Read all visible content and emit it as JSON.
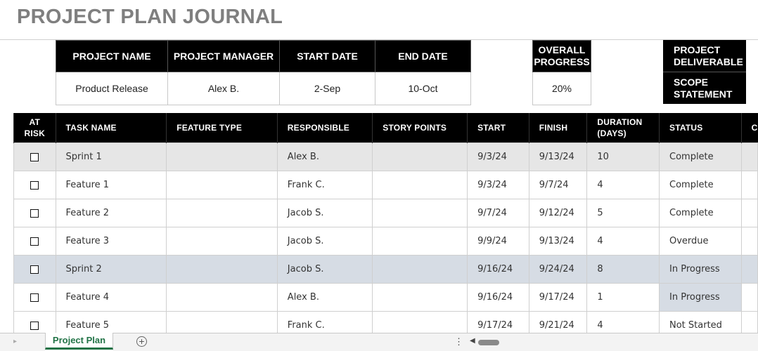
{
  "title": "PROJECT PLAN JOURNAL",
  "summary": {
    "headers": [
      "PROJECT NAME",
      "PROJECT MANAGER",
      "START DATE",
      "END DATE"
    ],
    "values": [
      "Product Release",
      "Alex B.",
      "2-Sep",
      "10-Oct"
    ],
    "progress_label_1": "OVERALL",
    "progress_label_2": "PROGRESS",
    "progress_value": "20%",
    "deliverable_label_1": "PROJECT",
    "deliverable_label_2": "DELIVERABLE",
    "scope_label_1": "SCOPE",
    "scope_label_2": "STATEMENT"
  },
  "table": {
    "headers": {
      "at_risk_1": "AT",
      "at_risk_2": "RISK",
      "task": "TASK NAME",
      "feature": "FEATURE TYPE",
      "responsible": "RESPONSIBLE",
      "points": "STORY POINTS",
      "start": "START",
      "finish": "FINISH",
      "duration_1": "DURATION",
      "duration_2": "(DAYS)",
      "status": "STATUS",
      "next": "C"
    },
    "rows": [
      {
        "task": "Sprint 1",
        "feature": "",
        "responsible": "Alex B.",
        "points": "",
        "start": "9/3/24",
        "finish": "9/13/24",
        "duration": "10",
        "status": "Complete"
      },
      {
        "task": "Feature 1",
        "feature": "",
        "responsible": "Frank C.",
        "points": "",
        "start": "9/3/24",
        "finish": "9/7/24",
        "duration": "4",
        "status": "Complete"
      },
      {
        "task": "Feature 2",
        "feature": "",
        "responsible": "Jacob S.",
        "points": "",
        "start": "9/7/24",
        "finish": "9/12/24",
        "duration": "5",
        "status": "Complete"
      },
      {
        "task": "Feature 3",
        "feature": "",
        "responsible": "Jacob S.",
        "points": "",
        "start": "9/9/24",
        "finish": "9/13/24",
        "duration": "4",
        "status": "Overdue"
      },
      {
        "task": "Sprint 2",
        "feature": "",
        "responsible": "Jacob S.",
        "points": "",
        "start": "9/16/24",
        "finish": "9/24/24",
        "duration": "8",
        "status": "In Progress"
      },
      {
        "task": "Feature 4",
        "feature": "",
        "responsible": "Alex B.",
        "points": "",
        "start": "9/16/24",
        "finish": "9/17/24",
        "duration": "1",
        "status": "In Progress"
      },
      {
        "task": "Feature 5",
        "feature": "",
        "responsible": "Frank C.",
        "points": "",
        "start": "9/17/24",
        "finish": "9/21/24",
        "duration": "4",
        "status": "Not Started"
      }
    ]
  },
  "sheet_tab": "Project Plan",
  "colors": {
    "sprint1_row": "#e6e6e6",
    "sprint2_row": "#d6dce4",
    "header": "#000000",
    "tab_accent": "#217346",
    "title": "#7f7f7f"
  }
}
